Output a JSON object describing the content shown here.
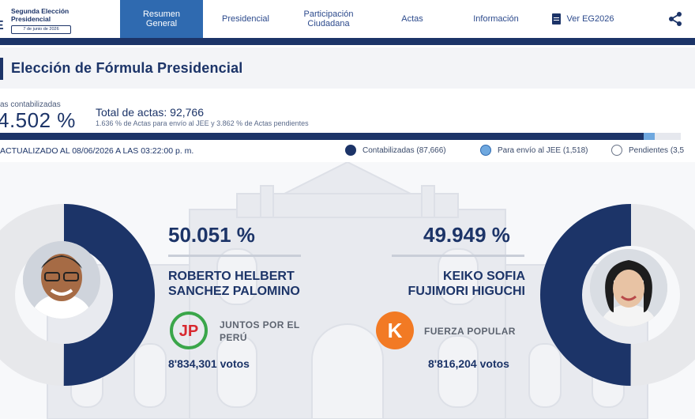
{
  "header": {
    "brand_title": "Segunda Elección Presidencial",
    "brand_date": "7 de junio de 2026",
    "nav": [
      {
        "label": "Resumen General",
        "active": true
      },
      {
        "label": "Presidencial",
        "active": false
      },
      {
        "label": "Participación Ciudadana",
        "active": false
      },
      {
        "label": "Actas",
        "active": false
      },
      {
        "label": "Información",
        "active": false
      },
      {
        "label": "Ver EG2026",
        "active": false
      }
    ]
  },
  "section": {
    "title": "Elección de Fórmula Presidencial"
  },
  "stats": {
    "counted_label": "as contabilizadas",
    "counted_pct": "4.502 %",
    "counted_fraction": 0.94502,
    "jee_fraction": 0.01636,
    "total_actas": "Total de actas: 92,766",
    "actas_sub": "1.636 % de Actas para envío al JEE y 3.862 % de Actas pendientes",
    "updated": "ACTUALIZADO AL 08/06/2026 A LAS 03:22:00 p. m.",
    "legend": [
      {
        "label": "Contabilizadas (87,666)",
        "color": "#1c3468"
      },
      {
        "label": "Para envío al JEE (1,518)",
        "color": "#6fa8df"
      },
      {
        "label": "Pendientes (3,5",
        "color": "#ffffff"
      }
    ]
  },
  "candidates": [
    {
      "pct": "50.051 %",
      "share": 0.50051,
      "name_line1": "ROBERTO HELBERT",
      "name_line2": "SANCHEZ PALOMINO",
      "party_line1": "JUNTOS POR EL",
      "party_line2": "PERÚ",
      "party_logo_text": "JP",
      "votes": "8'834,301 votos",
      "color": "#1c3468"
    },
    {
      "pct": "49.949 %",
      "share": 0.49949,
      "name_line1": "KEIKO SOFIA",
      "name_line2": "FUJIMORI HIGUCHI",
      "party_line1": "FUERZA POPULAR",
      "party_line2": "",
      "party_logo_text": "K",
      "votes": "8'816,204 votos",
      "color": "#1c3468"
    }
  ],
  "colors": {
    "navy": "#1c3468",
    "accent_blue": "#2f6ab0",
    "light_blue": "#6fa8df",
    "jp_green": "#3aa64a",
    "jp_red": "#d8282f",
    "fp_orange": "#f27a24"
  }
}
